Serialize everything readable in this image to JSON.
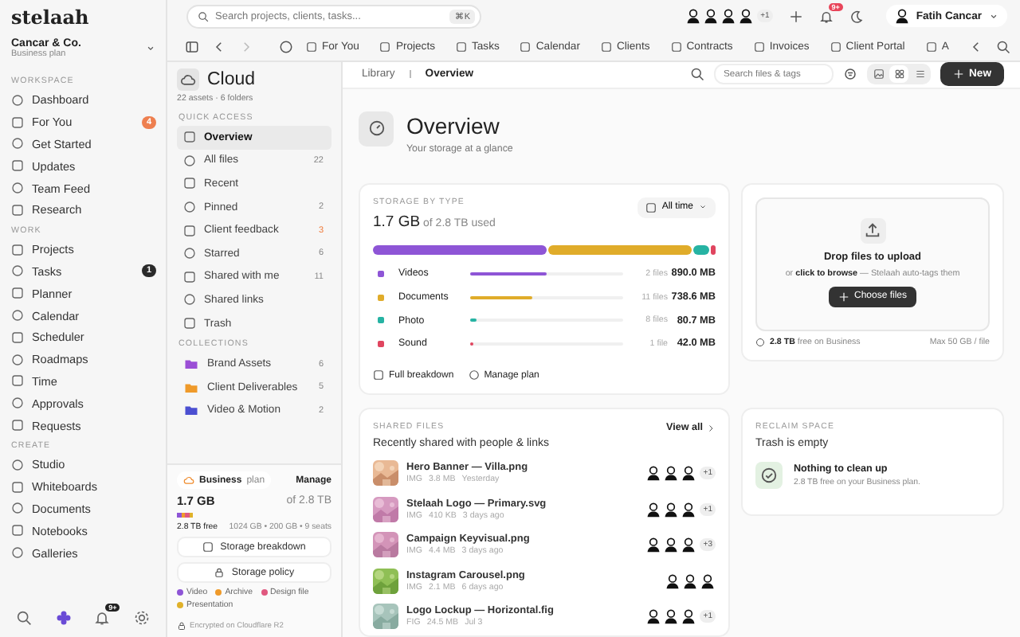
{
  "brand": {
    "logo": "stelaah",
    "org": "Cancar & Co.",
    "plan": "Business plan"
  },
  "nav": [
    {
      "title": "WORKSPACE",
      "items": [
        {
          "label": "Dashboard"
        },
        {
          "label": "For You",
          "badge": "4",
          "color": "#ee7f4f"
        },
        {
          "label": "Get Started"
        },
        {
          "label": "Updates"
        },
        {
          "label": "Team Feed"
        },
        {
          "label": "Research"
        }
      ]
    },
    {
      "title": "WORK",
      "items": [
        {
          "label": "Projects"
        },
        {
          "label": "Tasks",
          "badge": "1",
          "color": "#2a2a2a"
        },
        {
          "label": "Planner"
        },
        {
          "label": "Calendar"
        },
        {
          "label": "Scheduler"
        },
        {
          "label": "Roadmaps"
        },
        {
          "label": "Time"
        },
        {
          "label": "Approvals"
        },
        {
          "label": "Requests"
        }
      ]
    },
    {
      "title": "CREATE",
      "items": [
        {
          "label": "Studio"
        },
        {
          "label": "Whiteboards"
        },
        {
          "label": "Documents"
        },
        {
          "label": "Notebooks"
        },
        {
          "label": "Galleries"
        }
      ]
    }
  ],
  "dock_badge": "9+",
  "topbar": {
    "search_placeholder": "Search projects, clients, tasks...",
    "shortcut": "⌘K",
    "extra_people": "+1",
    "bell_badge": "9+",
    "user": "Fatih Cancar"
  },
  "tabs": [
    "For You",
    "Projects",
    "Tasks",
    "Calendar",
    "Clients",
    "Contracts",
    "Invoices",
    "Client Portal",
    "A"
  ],
  "cloud": {
    "title": "Cloud",
    "meta": "22 assets · 6 folders",
    "quick_title": "QUICK ACCESS",
    "quick_access": [
      {
        "label": "Overview",
        "selected": true
      },
      {
        "label": "All files",
        "count": "22",
        "selected": false
      },
      {
        "label": "Recent",
        "selected": false
      },
      {
        "label": "Pinned",
        "count": "2",
        "selected": false
      },
      {
        "label": "Client feedback",
        "count": "3",
        "alert": true,
        "selected": false
      },
      {
        "label": "Starred",
        "count": "6",
        "selected": false
      },
      {
        "label": "Shared with me",
        "count": "11",
        "selected": false
      },
      {
        "label": "Shared links",
        "selected": false
      },
      {
        "label": "Trash",
        "selected": false
      }
    ],
    "collections_title": "COLLECTIONS",
    "collections": [
      {
        "label": "Brand Assets",
        "count": "6",
        "color": "#9b4fd6"
      },
      {
        "label": "Client Deliverables",
        "count": "5",
        "color": "#ef9a2a"
      },
      {
        "label": "Video & Motion",
        "count": "2",
        "color": "#4b4fd1"
      }
    ],
    "plan": {
      "name": "Business",
      "suffix": "plan",
      "manage": "Manage",
      "used": "1.7 GB",
      "total": "of 2.8 TB",
      "free": "2.8 TB free",
      "detail": "1024 GB • 200 GB • 9 seats",
      "buttons": [
        "Storage breakdown",
        "Storage policy"
      ],
      "legend": [
        {
          "label": "Video",
          "color": "#8e55d6"
        },
        {
          "label": "Archive",
          "color": "#ef9a2a"
        },
        {
          "label": "Design file",
          "color": "#e0587f"
        },
        {
          "label": "Presentation",
          "color": "#e0b12a"
        }
      ],
      "footer": "Encrypted on Cloudflare R2"
    }
  },
  "main": {
    "breadcrumb": [
      "Library",
      "Overview"
    ],
    "search_placeholder": "Search files & tags",
    "view_modes": [
      {
        "selected": false
      },
      {
        "selected": true
      },
      {
        "selected": false
      }
    ],
    "new_button": "New",
    "title": "Overview",
    "subtitle": "Your storage at a glance",
    "storage": {
      "label": "STORAGE BY TYPE",
      "used": "1.7 GB",
      "of": "of 2.8 TB used",
      "range": "All time",
      "types": [
        {
          "name": "Videos",
          "color": "#8e55d6",
          "level": 0.5,
          "files": "2 files",
          "size": "890.0 MB"
        },
        {
          "name": "Documents",
          "color": "#e0ac2a",
          "level": 0.41,
          "files": "11 files",
          "size": "738.6 MB"
        },
        {
          "name": "Photo",
          "color": "#26b3a3",
          "level": 0.045,
          "files": "8 files",
          "size": "80.7 MB"
        },
        {
          "name": "Sound",
          "color": "#e0455f",
          "level": 0.015,
          "files": "1 file",
          "size": "42.0 MB"
        }
      ],
      "links": [
        "Full breakdown",
        "Manage plan"
      ]
    },
    "upload": {
      "title": "Drop files to upload",
      "hint": "or **click to browse** — Stelaah auto-tags them",
      "button": "Choose files",
      "free": "**2.8 TB** free on Business",
      "max": "Max 50 GB / file"
    },
    "shared": {
      "label": "SHARED FILES",
      "title": "Recently shared with people & links",
      "view_all": "View all",
      "files": [
        {
          "kind": "picture",
          "name": "Hero Banner — Villa.png",
          "type": "IMG",
          "size": "3.8 MB",
          "time": "Yesterday",
          "extra": "+1"
        },
        {
          "kind": "picture",
          "name": "Stelaah Logo — Primary.svg",
          "type": "IMG",
          "size": "410 KB",
          "time": "3 days ago",
          "extra": "+1"
        },
        {
          "kind": "picture",
          "name": "Campaign Keyvisual.png",
          "type": "IMG",
          "size": "4.4 MB",
          "time": "3 days ago",
          "extra": "+3"
        },
        {
          "kind": "picture",
          "name": "Instagram Carousel.png",
          "type": "IMG",
          "size": "2.1 MB",
          "time": "6 days ago"
        },
        {
          "kind": "picture",
          "name": "Logo Lockup — Horizontal.fig",
          "type": "FIG",
          "size": "24.5 MB",
          "time": "Jul 3",
          "extra": "+1"
        }
      ]
    },
    "reclaim": {
      "label": "RECLAIM SPACE",
      "title": "Trash is empty",
      "heading": "Nothing to clean up",
      "text": "2.8 TB free on your Business plan."
    }
  }
}
